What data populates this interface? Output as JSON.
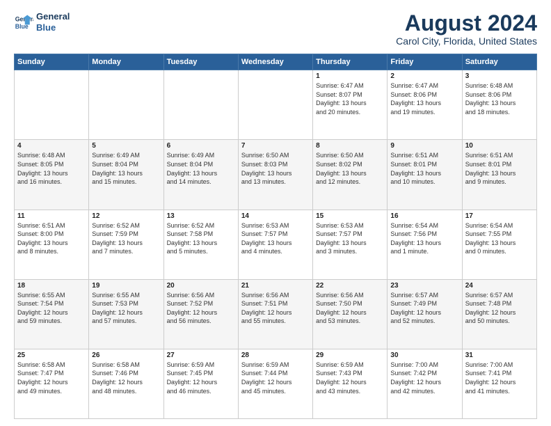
{
  "header": {
    "logo_line1": "General",
    "logo_line2": "Blue",
    "title": "August 2024",
    "subtitle": "Carol City, Florida, United States"
  },
  "weekdays": [
    "Sunday",
    "Monday",
    "Tuesday",
    "Wednesday",
    "Thursday",
    "Friday",
    "Saturday"
  ],
  "weeks": [
    [
      {
        "day": "",
        "content": ""
      },
      {
        "day": "",
        "content": ""
      },
      {
        "day": "",
        "content": ""
      },
      {
        "day": "",
        "content": ""
      },
      {
        "day": "1",
        "content": "Sunrise: 6:47 AM\nSunset: 8:07 PM\nDaylight: 13 hours\nand 20 minutes."
      },
      {
        "day": "2",
        "content": "Sunrise: 6:47 AM\nSunset: 8:06 PM\nDaylight: 13 hours\nand 19 minutes."
      },
      {
        "day": "3",
        "content": "Sunrise: 6:48 AM\nSunset: 8:06 PM\nDaylight: 13 hours\nand 18 minutes."
      }
    ],
    [
      {
        "day": "4",
        "content": "Sunrise: 6:48 AM\nSunset: 8:05 PM\nDaylight: 13 hours\nand 16 minutes."
      },
      {
        "day": "5",
        "content": "Sunrise: 6:49 AM\nSunset: 8:04 PM\nDaylight: 13 hours\nand 15 minutes."
      },
      {
        "day": "6",
        "content": "Sunrise: 6:49 AM\nSunset: 8:04 PM\nDaylight: 13 hours\nand 14 minutes."
      },
      {
        "day": "7",
        "content": "Sunrise: 6:50 AM\nSunset: 8:03 PM\nDaylight: 13 hours\nand 13 minutes."
      },
      {
        "day": "8",
        "content": "Sunrise: 6:50 AM\nSunset: 8:02 PM\nDaylight: 13 hours\nand 12 minutes."
      },
      {
        "day": "9",
        "content": "Sunrise: 6:51 AM\nSunset: 8:01 PM\nDaylight: 13 hours\nand 10 minutes."
      },
      {
        "day": "10",
        "content": "Sunrise: 6:51 AM\nSunset: 8:01 PM\nDaylight: 13 hours\nand 9 minutes."
      }
    ],
    [
      {
        "day": "11",
        "content": "Sunrise: 6:51 AM\nSunset: 8:00 PM\nDaylight: 13 hours\nand 8 minutes."
      },
      {
        "day": "12",
        "content": "Sunrise: 6:52 AM\nSunset: 7:59 PM\nDaylight: 13 hours\nand 7 minutes."
      },
      {
        "day": "13",
        "content": "Sunrise: 6:52 AM\nSunset: 7:58 PM\nDaylight: 13 hours\nand 5 minutes."
      },
      {
        "day": "14",
        "content": "Sunrise: 6:53 AM\nSunset: 7:57 PM\nDaylight: 13 hours\nand 4 minutes."
      },
      {
        "day": "15",
        "content": "Sunrise: 6:53 AM\nSunset: 7:57 PM\nDaylight: 13 hours\nand 3 minutes."
      },
      {
        "day": "16",
        "content": "Sunrise: 6:54 AM\nSunset: 7:56 PM\nDaylight: 13 hours\nand 1 minute."
      },
      {
        "day": "17",
        "content": "Sunrise: 6:54 AM\nSunset: 7:55 PM\nDaylight: 13 hours\nand 0 minutes."
      }
    ],
    [
      {
        "day": "18",
        "content": "Sunrise: 6:55 AM\nSunset: 7:54 PM\nDaylight: 12 hours\nand 59 minutes."
      },
      {
        "day": "19",
        "content": "Sunrise: 6:55 AM\nSunset: 7:53 PM\nDaylight: 12 hours\nand 57 minutes."
      },
      {
        "day": "20",
        "content": "Sunrise: 6:56 AM\nSunset: 7:52 PM\nDaylight: 12 hours\nand 56 minutes."
      },
      {
        "day": "21",
        "content": "Sunrise: 6:56 AM\nSunset: 7:51 PM\nDaylight: 12 hours\nand 55 minutes."
      },
      {
        "day": "22",
        "content": "Sunrise: 6:56 AM\nSunset: 7:50 PM\nDaylight: 12 hours\nand 53 minutes."
      },
      {
        "day": "23",
        "content": "Sunrise: 6:57 AM\nSunset: 7:49 PM\nDaylight: 12 hours\nand 52 minutes."
      },
      {
        "day": "24",
        "content": "Sunrise: 6:57 AM\nSunset: 7:48 PM\nDaylight: 12 hours\nand 50 minutes."
      }
    ],
    [
      {
        "day": "25",
        "content": "Sunrise: 6:58 AM\nSunset: 7:47 PM\nDaylight: 12 hours\nand 49 minutes."
      },
      {
        "day": "26",
        "content": "Sunrise: 6:58 AM\nSunset: 7:46 PM\nDaylight: 12 hours\nand 48 minutes."
      },
      {
        "day": "27",
        "content": "Sunrise: 6:59 AM\nSunset: 7:45 PM\nDaylight: 12 hours\nand 46 minutes."
      },
      {
        "day": "28",
        "content": "Sunrise: 6:59 AM\nSunset: 7:44 PM\nDaylight: 12 hours\nand 45 minutes."
      },
      {
        "day": "29",
        "content": "Sunrise: 6:59 AM\nSunset: 7:43 PM\nDaylight: 12 hours\nand 43 minutes."
      },
      {
        "day": "30",
        "content": "Sunrise: 7:00 AM\nSunset: 7:42 PM\nDaylight: 12 hours\nand 42 minutes."
      },
      {
        "day": "31",
        "content": "Sunrise: 7:00 AM\nSunset: 7:41 PM\nDaylight: 12 hours\nand 41 minutes."
      }
    ]
  ]
}
